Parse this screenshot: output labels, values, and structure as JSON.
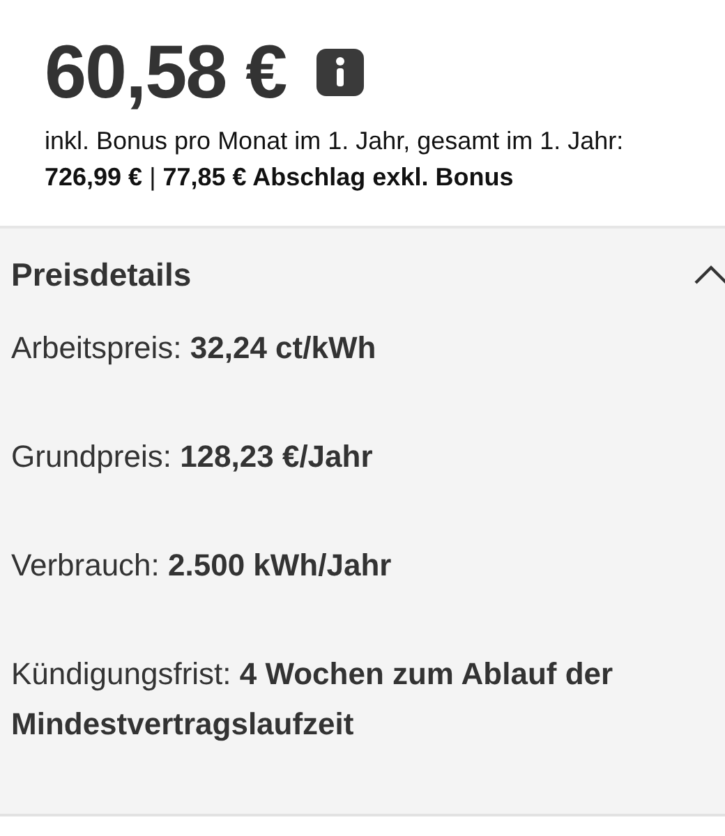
{
  "price": {
    "amount": "60,58 €",
    "description": "inkl. Bonus pro Monat im 1. Jahr, gesamt im 1. Jahr: **726,99 €** | **77,85 € Abschlag exkl. Bonus**"
  },
  "details": {
    "title": "Preisdetails",
    "expanded": true,
    "items": [
      {
        "label": "Arbeitspreis:",
        "value": "32,24 ct/kWh"
      },
      {
        "label": "Grundpreis:",
        "value": "128,23 €/Jahr"
      },
      {
        "label": "Verbrauch:",
        "value": "2.500 kWh/Jahr"
      },
      {
        "label": "Kündigungsfrist:",
        "value": "4 Wochen zum Ablauf der Mindestvertragslaufzeit"
      }
    ]
  }
}
